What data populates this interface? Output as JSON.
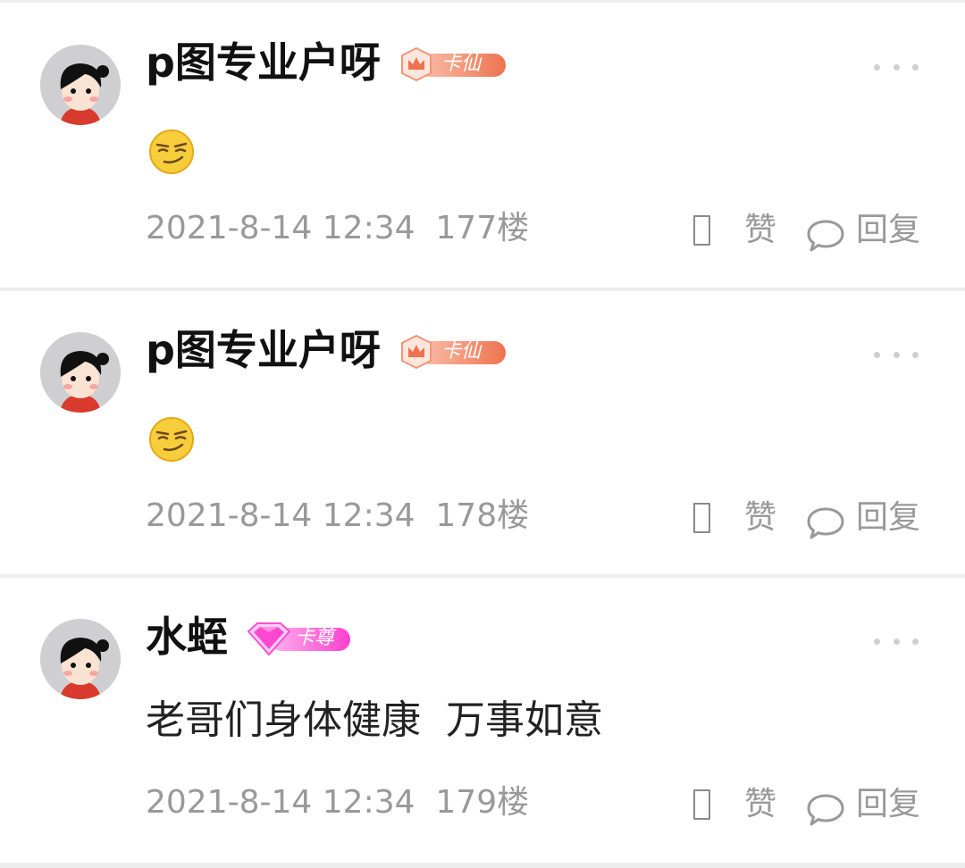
{
  "posts": [
    {
      "username": "p图专业户呀",
      "badge": {
        "type": "crown",
        "label": "卡仙",
        "color_start": "#f9c0ac",
        "color_end": "#ee7350"
      },
      "content_type": "emoji",
      "emoji": "smirk-face",
      "date": "2021-8-14 12:34",
      "floor": "177楼",
      "like_label": "赞",
      "reply_label": "回复"
    },
    {
      "username": "p图专业户呀",
      "badge": {
        "type": "crown",
        "label": "卡仙",
        "color_start": "#f9c0ac",
        "color_end": "#ee7350"
      },
      "content_type": "emoji",
      "emoji": "smirk-face",
      "date": "2021-8-14 12:34",
      "floor": "178楼",
      "like_label": "赞",
      "reply_label": "回复"
    },
    {
      "username": "水蛭",
      "badge": {
        "type": "gem",
        "label": "卡尊",
        "color_start": "#ffb3ee",
        "color_end": "#ff3fcf"
      },
      "content_type": "text",
      "text": "老哥们身体健康  万事如意",
      "date": "2021-8-14 12:34",
      "floor": "179楼",
      "like_label": "赞",
      "reply_label": "回复"
    }
  ]
}
